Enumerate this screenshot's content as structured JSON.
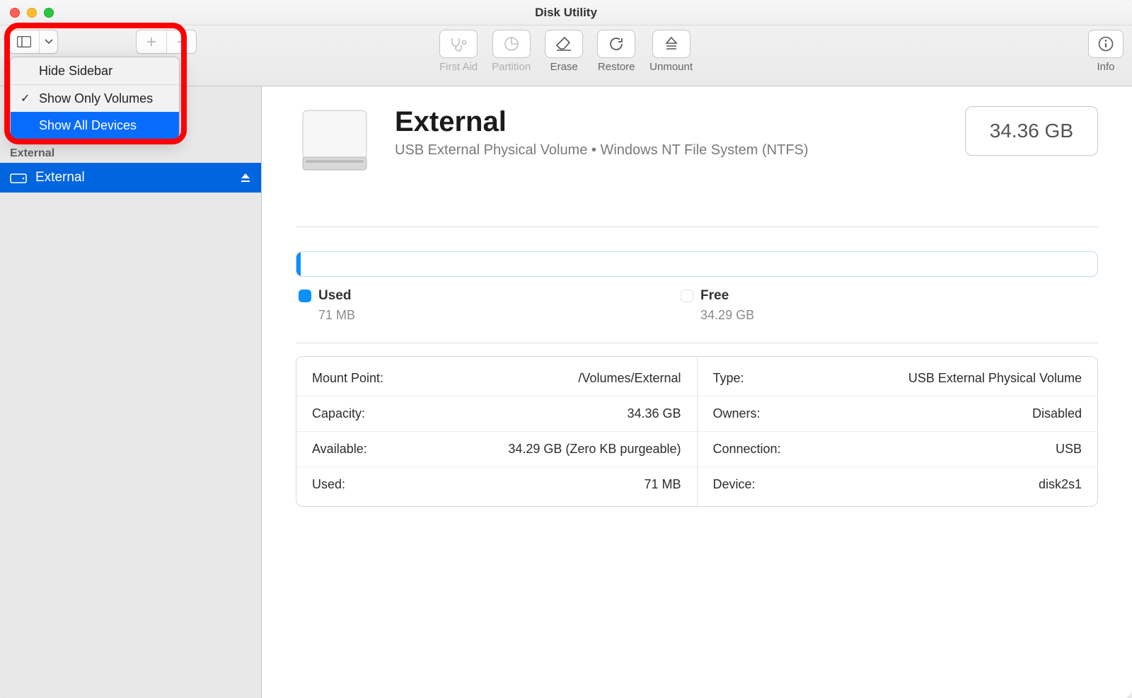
{
  "window": {
    "title": "Disk Utility"
  },
  "toolbar": {
    "first_aid": "First Aid",
    "partition": "Partition",
    "erase": "Erase",
    "restore": "Restore",
    "unmount": "Unmount",
    "info": "Info"
  },
  "dropdown": {
    "hide_sidebar": "Hide Sidebar",
    "show_only_volumes": "Show Only Volumes",
    "show_all_devices": "Show All Devices"
  },
  "sidebar": {
    "section": "External",
    "item": "External"
  },
  "hero": {
    "name": "External",
    "subtitle": "USB External Physical Volume • Windows NT File System (NTFS)",
    "badge": "34.36 GB"
  },
  "legend": {
    "used_label": "Used",
    "used_value": "71 MB",
    "free_label": "Free",
    "free_value": "34.29 GB"
  },
  "details": {
    "left": [
      {
        "k": "Mount Point:",
        "v": "/Volumes/External"
      },
      {
        "k": "Capacity:",
        "v": "34.36 GB"
      },
      {
        "k": "Available:",
        "v": "34.29 GB (Zero KB purgeable)"
      },
      {
        "k": "Used:",
        "v": "71 MB"
      }
    ],
    "right": [
      {
        "k": "Type:",
        "v": "USB External Physical Volume"
      },
      {
        "k": "Owners:",
        "v": "Disabled"
      },
      {
        "k": "Connection:",
        "v": "USB"
      },
      {
        "k": "Device:",
        "v": "disk2s1"
      }
    ]
  }
}
